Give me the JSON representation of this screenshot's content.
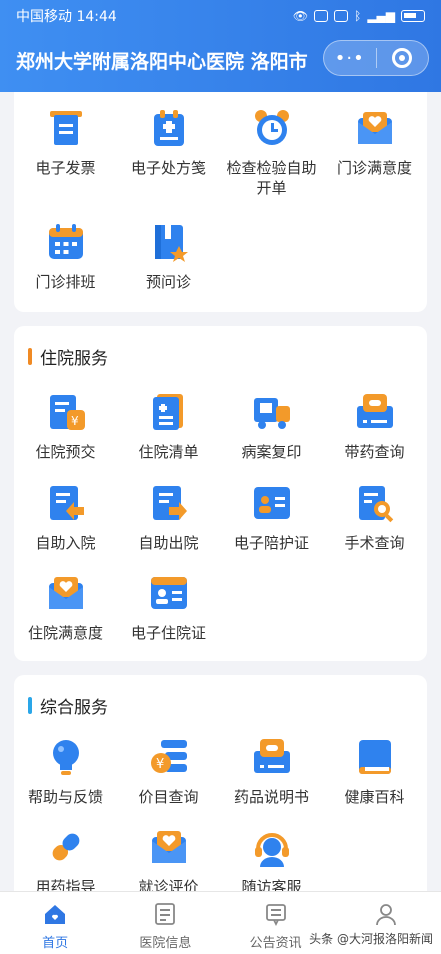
{
  "status_bar": {
    "carrier_time": "中国移动 14:44"
  },
  "header": {
    "title": "郑州大学附属洛阳中心医院 洛阳市"
  },
  "top_section": {
    "items": [
      {
        "label": "电子发票",
        "icon": "invoice-icon"
      },
      {
        "label": "电子处方笺",
        "icon": "prescription-icon"
      },
      {
        "label": "检查检验自助开单",
        "icon": "alarm-clock-icon"
      },
      {
        "label": "门诊满意度",
        "icon": "heart-envelope-icon"
      },
      {
        "label": "门诊排班",
        "icon": "calendar-icon"
      },
      {
        "label": "预问诊",
        "icon": "bookmark-star-icon"
      }
    ]
  },
  "inpatient": {
    "title": "住院服务",
    "accent": "#f08a24",
    "items": [
      {
        "label": "住院预交",
        "icon": "payment-doc-icon"
      },
      {
        "label": "住院清单",
        "icon": "checklist-icon"
      },
      {
        "label": "病案复印",
        "icon": "truck-icon"
      },
      {
        "label": "带药查询",
        "icon": "medicine-box-icon"
      },
      {
        "label": "自助入院",
        "icon": "admit-doc-icon"
      },
      {
        "label": "自助出院",
        "icon": "discharge-doc-icon"
      },
      {
        "label": "电子陪护证",
        "icon": "id-card-icon"
      },
      {
        "label": "手术查询",
        "icon": "search-doc-icon"
      },
      {
        "label": "住院满意度",
        "icon": "heart-envelope-icon"
      },
      {
        "label": "电子住院证",
        "icon": "id-card-icon"
      }
    ]
  },
  "general": {
    "title": "综合服务",
    "accent": "#2aa6e8",
    "items": [
      {
        "label": "帮助与反馈",
        "icon": "lightbulb-icon"
      },
      {
        "label": "价目查询",
        "icon": "price-list-icon"
      },
      {
        "label": "药品说明书",
        "icon": "medicine-box-icon"
      },
      {
        "label": "健康百科",
        "icon": "book-icon"
      },
      {
        "label": "用药指导",
        "icon": "pill-icon"
      },
      {
        "label": "就诊评价",
        "icon": "heart-envelope-icon"
      },
      {
        "label": "随访客服",
        "icon": "headset-icon"
      }
    ]
  },
  "bottom_nav": {
    "items": [
      {
        "label": "首页",
        "icon": "home-icon"
      },
      {
        "label": "医院信息",
        "icon": "hospital-info-icon"
      },
      {
        "label": "公告资讯",
        "icon": "notice-icon"
      },
      {
        "label": "",
        "icon": "user-icon"
      }
    ]
  },
  "watermark": "头条 @大河报洛阳新闻"
}
